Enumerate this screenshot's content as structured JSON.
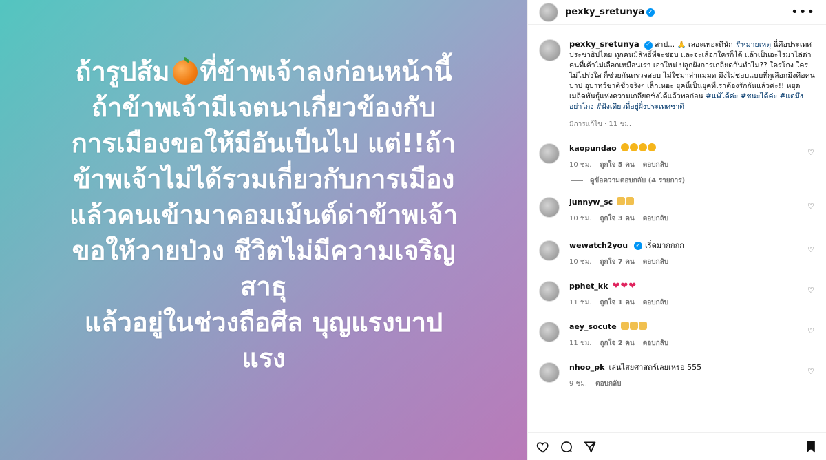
{
  "post": {
    "image_lines": [
      "ถ้ารูปส้ม",
      "ที่ข้าพเจ้าลงก่อนหน้านี้",
      "ถ้าข้าพเจ้ามีเจตนาเกี่ยวข้องกับ",
      "การเมืองขอให้มีอันเป็นไป แต่!!ถ้า",
      "ข้าพเจ้าไม่ได้รวมเกี่ยวกับการเมือง",
      "แล้วคนเข้ามาคอมเม้นต์ด่าข้าพเจ้า",
      "ขอให้วายป่วง ชีวิตไม่มีความเจริญ",
      "สาธุ",
      "แล้วอยู่ในช่วงถือศีล  บุญแรงบาป",
      "แรง"
    ]
  },
  "header": {
    "username": "pexky_sretunya",
    "more_label": "•••"
  },
  "caption": {
    "username": "pexky_sretunya",
    "text_a": "สาป... 🙏 เลอะเทอะดีนัก ",
    "hashtag_1": "#หมายเหตุ",
    "text_b": " นี่คือประเทศประชาธิปไตย ทุกคนมีสิทธิ์ที่จะชอบ และจะเลือกใครก็ได้ แล้วเป็นอะไรมาไล่ด่าคนที่เค้าไม่เลือกเหมือนเรา เอาใหม่ ปลูกฝังการเกลียดกันทำไม?? ใครโกง ใครไม่โปร่งใส ก็ช่วยกันตรวจสอบ ไม่ใช่มาล่าแม่มด มึงไม่ชอบแบบที่กูเลือกมึงคือคนบาป อุบาทว์ชาติชั่วจริงๆ เล็กเหอะ ยุคนี้เป็นยุคที่เราต้องรักกันแล้วค่ะ!! หยุด เมล็ดพันธุ์แห่งความเกลียดชังได้แล้วพอก่อน ",
    "hashtags_end": "#แพ้ได้ค่ะ #ชนะได้ค่ะ #แต่มึงอย่าโกง #ฝังเดียวที่อยู่ฝั่งประเทศชาติ",
    "meta": "มีการแก้ไข · 11 ชม."
  },
  "comments": [
    {
      "username": "kaopundao",
      "text": "",
      "emoji": "face",
      "emoji_count": 4,
      "time": "10 ชม.",
      "likes": "ถูกใจ 5 คน",
      "reply": "ตอบกลับ"
    },
    {
      "username": "junnyw_sc",
      "text": "",
      "emoji": "clap",
      "emoji_count": 2,
      "time": "10 ชม.",
      "likes": "ถูกใจ 3 คน",
      "reply": "ตอบกลับ"
    },
    {
      "username": "wewatch2you",
      "text": "เริ่ดมากกกก",
      "emoji": "",
      "emoji_count": 0,
      "time": "10 ชม.",
      "likes": "ถูกใจ 7 คน",
      "reply": "ตอบกลับ"
    },
    {
      "username": "pphet_kk",
      "text": "",
      "emoji": "heart",
      "emoji_count": 3,
      "time": "11 ชม.",
      "likes": "ถูกใจ 1 คน",
      "reply": "ตอบกลับ"
    },
    {
      "username": "aey_socute",
      "text": "",
      "emoji": "clap",
      "emoji_count": 3,
      "time": "11 ชม.",
      "likes": "ถูกใจ 2 คน",
      "reply": "ตอบกลับ"
    },
    {
      "username": "nhoo_pk",
      "text": "เล่นไสยศาสตร์เลยเหรอ 555",
      "emoji": "",
      "emoji_count": 0,
      "time": "9 ชม.",
      "likes": "",
      "reply": "ตอบกลับ"
    }
  ],
  "replies_link": "ดูข้อความตอบกลับ (4 รายการ)",
  "colors": {
    "gradient_start": "#4cc3bd",
    "gradient_end": "#c07fc0",
    "verified": "#0095f6",
    "hashtag": "#00376b",
    "heart": "#e0245e"
  },
  "icons": [
    "heart-icon",
    "comment-icon",
    "share-icon",
    "bookmark-icon",
    "verified-icon",
    "more-icon",
    "orange-emoji-icon"
  ]
}
